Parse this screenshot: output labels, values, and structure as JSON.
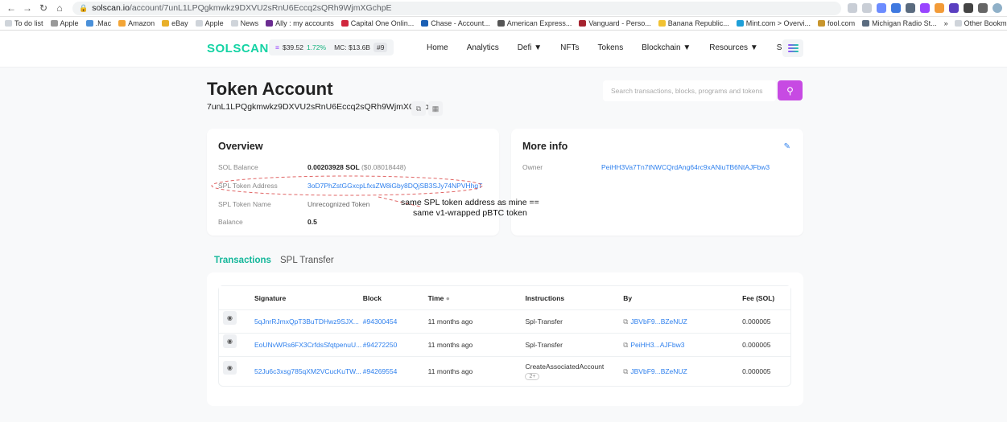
{
  "browser": {
    "url_host": "solscan.io",
    "url_path": "/account/7unL1LPQgkmwkz9DXVU2sRnU6Eccq2sQRh9WjmXGchpE",
    "bookmarks": [
      "To do list",
      "Apple",
      ".Mac",
      "Amazon",
      "eBay",
      "Apple",
      "News",
      "Ally : my accounts",
      "Capital One Onlin...",
      "Chase - Account...",
      "American Express...",
      "Vanguard - Perso...",
      "Banana Republic...",
      "Mint.com > Overvi...",
      "fool.com",
      "Michigan Radio St..."
    ],
    "other_bookmarks": "Other Bookmarks",
    "overflow": "»"
  },
  "header": {
    "logo": "SOLSCAN",
    "price": "$39.52",
    "price_change": "1.72%",
    "market_cap": "MC: $13.6B",
    "rank": "#9",
    "nav": [
      "Home",
      "Analytics",
      "Defi ▼",
      "NFTs",
      "Tokens",
      "Blockchain ▼",
      "Resources ▼",
      "Sign in"
    ]
  },
  "page": {
    "title": "Token Account",
    "address": "7unL1LPQgkmwkz9DXVU2sRnU6Eccq2sQRh9WjmXGchpE",
    "search_placeholder": "Search transactions, blocks, programs and tokens"
  },
  "overview": {
    "title": "Overview",
    "rows": [
      {
        "label": "SOL Balance",
        "value": "0.00203928 SOL",
        "usd": "($0.08018448)"
      },
      {
        "label": "SPL Token Address",
        "value": "3oD7PhZstGGxcpLfxsZW8iGby8DQjSB3SJy74NPVHhgT"
      },
      {
        "label": "SPL Token Name",
        "value": "Unrecognized Token"
      },
      {
        "label": "Balance",
        "value": "0.5"
      }
    ]
  },
  "more_info": {
    "title": "More info",
    "owner_label": "Owner",
    "owner_value": "PeiHH3Va7Tn7tNWCQrdAng64rc9xANiuTB6NtAJFbw3"
  },
  "annotation": {
    "line1": "same SPL token address as mine ==",
    "line2": "same v1-wrapped pBTC token"
  },
  "tabs": {
    "active": "Transactions",
    "inactive": "SPL Transfer"
  },
  "table": {
    "headers": {
      "signature": "Signature",
      "block": "Block",
      "time": "Time",
      "instructions": "Instructions",
      "by": "By",
      "fee": "Fee (SOL)"
    },
    "rows": [
      {
        "signature": "5qJnrRJmxQpT3BuTDHwz9SJX...",
        "block": "#94300454",
        "time": "11 months ago",
        "instructions": "Spl-Transfer",
        "by": "JBVbF9...BZeNUZ",
        "fee": "0.000005"
      },
      {
        "signature": "EoUNvWRs6FX3CrfdsSfqtpenuU...",
        "block": "#94272250",
        "time": "11 months ago",
        "instructions": "Spl-Transfer",
        "by": "PeiHH3...AJFbw3",
        "fee": "0.000005"
      },
      {
        "signature": "52Ju6c3xsg785qXM2VCucKuTW...",
        "block": "#94269554",
        "time": "11 months ago",
        "instructions": "CreateAssociatedAccount",
        "instructions_badge": "2+",
        "by": "JBVbF9...BZeNUZ",
        "fee": "0.000005"
      }
    ]
  },
  "colors": {
    "accent": "#14d3a4",
    "link": "#2f80ed",
    "search_button": "#c74ae3"
  }
}
